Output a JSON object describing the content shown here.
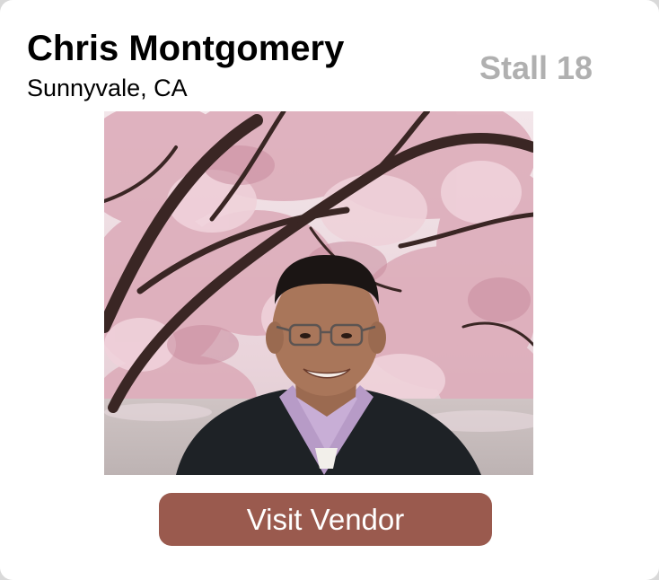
{
  "vendor": {
    "name": "Chris Montgomery",
    "location": "Sunnyvale, CA",
    "stall": "Stall 18"
  },
  "actions": {
    "visit_label": "Visit Vendor"
  },
  "photo": {
    "subject": "vendor portrait in front of blooming cherry tree"
  },
  "colors": {
    "button_bg": "#9a5a4e",
    "stall_text": "#b0b0b0",
    "card_bg": "#ffffff"
  }
}
